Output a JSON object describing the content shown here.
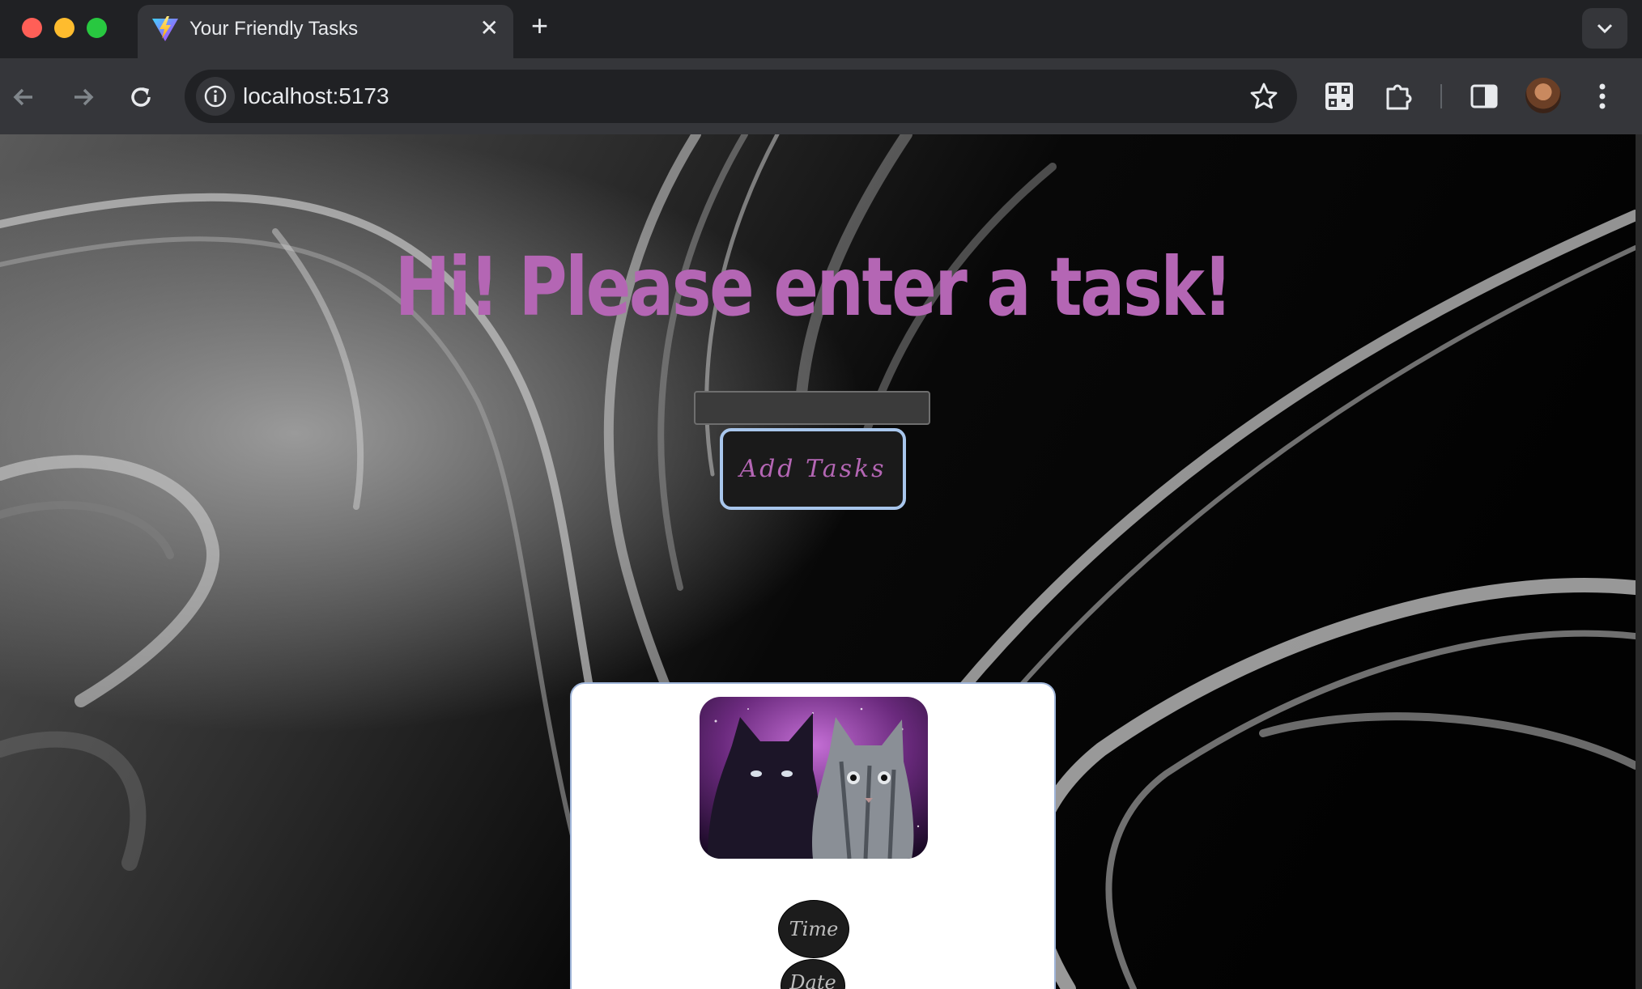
{
  "browser": {
    "tab_title": "Your Friendly Tasks",
    "url": "localhost:5173"
  },
  "page": {
    "headline": "Hi! Please enter a task!",
    "task_input_value": "",
    "add_button_label": "Add Tasks",
    "card": {
      "time_button_label": "Time",
      "date_button_label": "Date"
    }
  },
  "colors": {
    "accent_purple": "#b466b4",
    "button_border": "#a8c6ec",
    "chrome_dark": "#202124",
    "chrome_toolbar": "#35363a"
  },
  "icons": [
    "vite-favicon",
    "close-icon",
    "plus-icon",
    "chevron-down-icon",
    "back-arrow-icon",
    "forward-arrow-icon",
    "reload-icon",
    "site-info-icon",
    "star-icon",
    "qr-code-icon",
    "extensions-icon",
    "side-panel-icon",
    "profile-avatar",
    "kebab-menu-icon"
  ]
}
